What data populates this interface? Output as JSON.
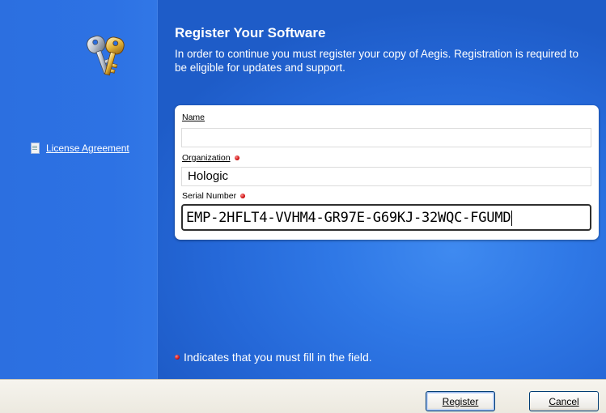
{
  "header": {
    "title": "Register Your Software",
    "subtitle": "In order to continue you must register your copy of Aegis. Registration is required to be eligible for updates and support."
  },
  "sidebar": {
    "license_label": "License Agreement"
  },
  "form": {
    "name_label": "Name",
    "name_value": "",
    "organization_label": "Organization",
    "organization_value": "Hologic",
    "serial_label": "Serial Number",
    "serial_value": "EMP-2HFLT4-VVHM4-GR97E-G69KJ-32WQC-FGUMD"
  },
  "note": "Indicates that you must fill in the field.",
  "buttons": {
    "register": "Register",
    "cancel": "Cancel"
  },
  "icons": {
    "keys": "keys-icon",
    "document": "document-icon",
    "required": "required-dot-icon"
  },
  "colors": {
    "background": "#2a6ee0",
    "required": "#d40000"
  }
}
